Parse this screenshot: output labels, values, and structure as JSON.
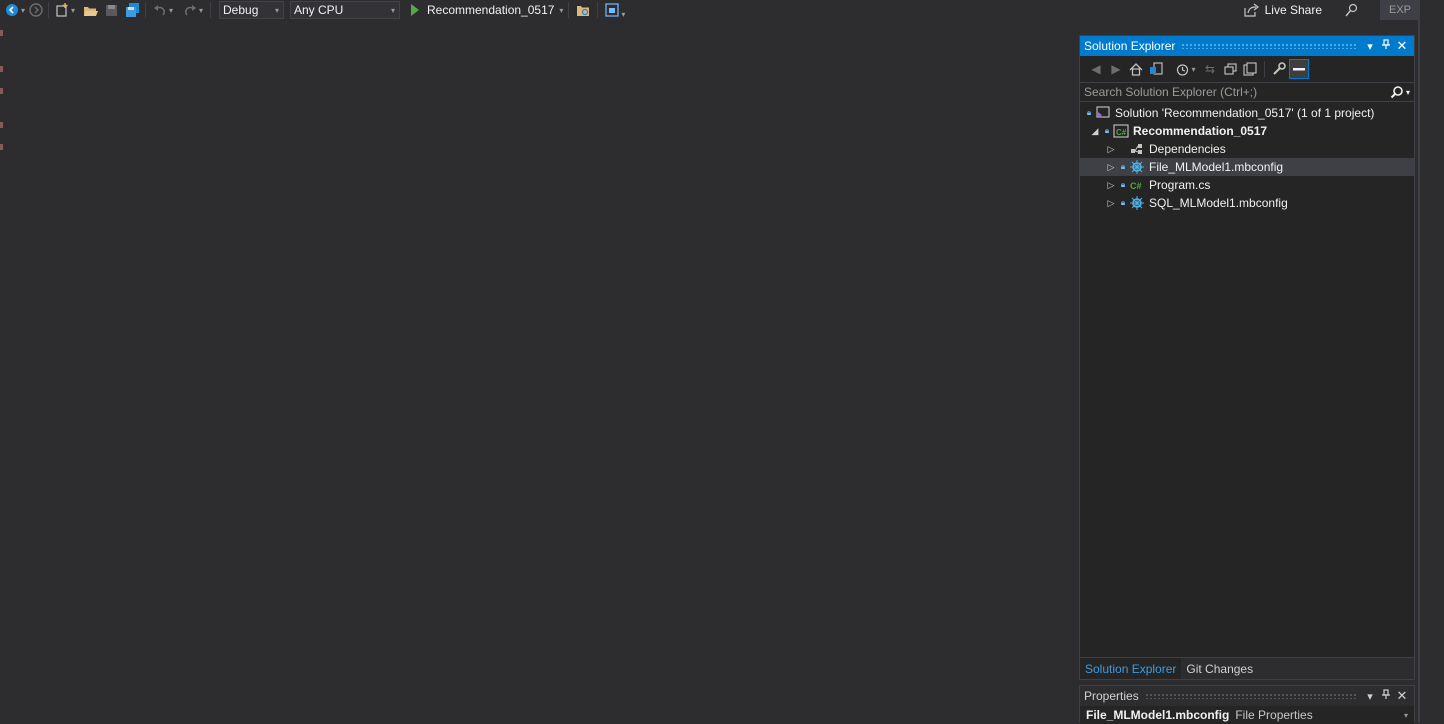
{
  "toolbar": {
    "configuration": "Debug",
    "platform": "Any CPU",
    "startup_project": "Recommendation_0517",
    "live_share_label": "Live Share",
    "exp_badge": "EXP",
    "icons": [
      "back-icon",
      "forward-icon",
      "new-project-icon",
      "open-folder-icon",
      "save-icon",
      "save-all-icon",
      "undo-icon",
      "redo-icon",
      "play-icon",
      "browse-folder-icon",
      "window-layout-icon",
      "live-share-icon",
      "feedback-icon"
    ]
  },
  "solution_explorer": {
    "title": "Solution Explorer",
    "search_placeholder": "Search Solution Explorer (Ctrl+;)",
    "tree": {
      "solution": "Solution 'Recommendation_0517' (1 of 1 project)",
      "project": "Recommendation_0517",
      "items": [
        {
          "label": "Dependencies",
          "icon": "dependencies-icon"
        },
        {
          "label": "File_MLModel1.mbconfig",
          "icon": "mbconfig-icon",
          "selected": true
        },
        {
          "label": "Program.cs",
          "icon": "csharp-file-icon"
        },
        {
          "label": "SQL_MLModel1.mbconfig",
          "icon": "mbconfig-icon"
        }
      ]
    },
    "tabs": [
      "Solution Explorer",
      "Git Changes"
    ],
    "active_tab": "Solution Explorer"
  },
  "properties": {
    "title": "Properties",
    "selected_object": "File_MLModel1.mbconfig",
    "selected_kind": "File Properties"
  },
  "colors": {
    "accent": "#007acc",
    "background": "#2d2d30",
    "panel": "#252526",
    "run_green": "#57a64a",
    "link_blue": "#3e9bde"
  }
}
